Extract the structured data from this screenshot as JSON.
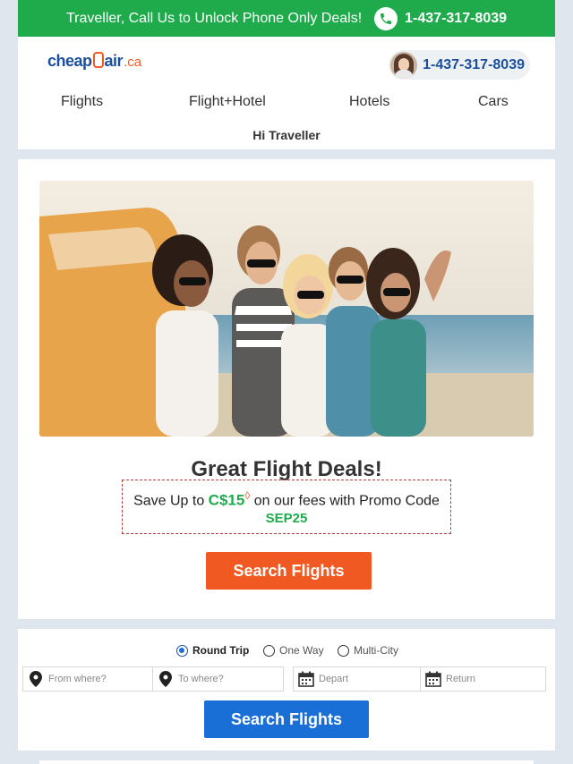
{
  "topbar": {
    "promo_text": "Traveller, Call Us to Unlock Phone Only Deals!",
    "phone": "1-437-317-8039",
    "bg_color": "#1fab4c"
  },
  "header": {
    "logo": {
      "cheap": "cheap",
      "o": "O",
      "air": "air",
      "ca": ".ca"
    },
    "agent_phone": "1-437-317-8039",
    "nav": [
      {
        "label": "Flights"
      },
      {
        "label": "Flight+Hotel"
      },
      {
        "label": "Hotels"
      },
      {
        "label": "Cars"
      }
    ],
    "greeting": "Hi Traveller"
  },
  "hero": {
    "title": "Great Flight Deals!",
    "promo_prefix": "Save Up to ",
    "promo_amount": "C$15",
    "promo_mark": "◊",
    "promo_suffix": " on our fees with Promo Code",
    "promo_code": "SEP25",
    "cta_label": "Search Flights",
    "cta_color": "#f05a22"
  },
  "search": {
    "trip_types": [
      {
        "label": "Round Trip",
        "selected": true
      },
      {
        "label": "One Way",
        "selected": false
      },
      {
        "label": "Multi-City",
        "selected": false
      }
    ],
    "from_placeholder": "From where?",
    "to_placeholder": "To where?",
    "depart_placeholder": "Depart",
    "return_placeholder": "Return",
    "cta_label": "Search Flights",
    "cta_color": "#1a6fd6"
  }
}
